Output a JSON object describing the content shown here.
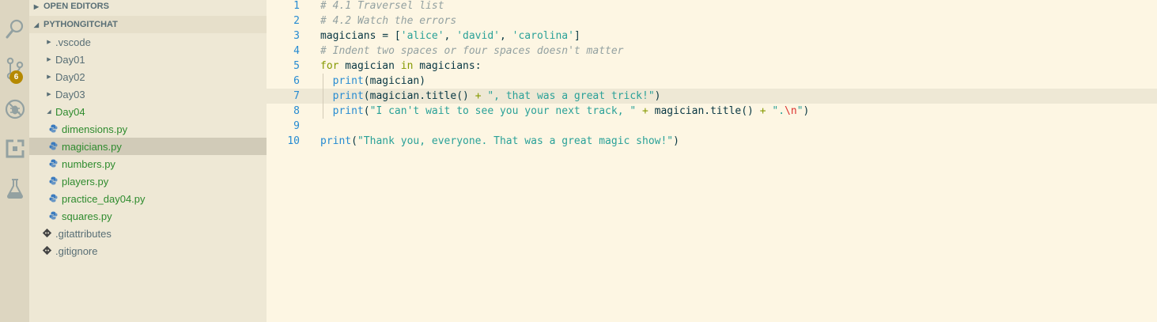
{
  "activity_bar": {
    "items": [
      {
        "icon": "search-icon"
      },
      {
        "icon": "source-control-icon",
        "badge": "6"
      },
      {
        "icon": "debug-icon"
      },
      {
        "icon": "extensions-icon"
      },
      {
        "icon": "flask-icon"
      }
    ]
  },
  "sidebar": {
    "open_editors_label": "OPEN EDITORS",
    "project_label": "PYTHONGITCHAT",
    "tree": [
      {
        "label": ".vscode",
        "kind": "folder"
      },
      {
        "label": "Day01",
        "kind": "folder"
      },
      {
        "label": "Day02",
        "kind": "folder"
      },
      {
        "label": "Day03",
        "kind": "folder"
      },
      {
        "label": "Day04",
        "kind": "folder-open"
      },
      {
        "label": "dimensions.py",
        "kind": "python",
        "status": "U"
      },
      {
        "label": "magicians.py",
        "kind": "python",
        "status": "U",
        "selected": true
      },
      {
        "label": "numbers.py",
        "kind": "python",
        "status": "U"
      },
      {
        "label": "players.py",
        "kind": "python",
        "status": "U"
      },
      {
        "label": "practice_day04.py",
        "kind": "python",
        "status": "U"
      },
      {
        "label": "squares.py",
        "kind": "python",
        "status": "U"
      },
      {
        "label": ".gitattributes",
        "kind": "git"
      },
      {
        "label": ".gitignore",
        "kind": "git"
      }
    ]
  },
  "editor": {
    "lines": [
      {
        "n": "1",
        "tokens": [
          [
            "cm",
            "# 4.1 Traversel list"
          ]
        ]
      },
      {
        "n": "2",
        "tokens": [
          [
            "cm",
            "# 4.2 Watch the errors"
          ]
        ]
      },
      {
        "n": "3",
        "tokens": [
          [
            "",
            "magicians = ["
          ],
          [
            "str",
            "'alice'"
          ],
          [
            "",
            ", "
          ],
          [
            "str",
            "'david'"
          ],
          [
            "",
            ", "
          ],
          [
            "str",
            "'carolina'"
          ],
          [
            "",
            "]"
          ]
        ]
      },
      {
        "n": "4",
        "tokens": [
          [
            "cm",
            "# Indent two spaces or four spaces doesn't matter"
          ]
        ]
      },
      {
        "n": "5",
        "tokens": [
          [
            "kw",
            "for"
          ],
          [
            "",
            " magician "
          ],
          [
            "kw",
            "in"
          ],
          [
            "",
            " magicians:"
          ]
        ]
      },
      {
        "n": "6",
        "indent": true,
        "tokens": [
          [
            "",
            "  "
          ],
          [
            "fn",
            "print"
          ],
          [
            "",
            "(magician)"
          ]
        ]
      },
      {
        "n": "7",
        "indent": true,
        "current": true,
        "tokens": [
          [
            "",
            "  "
          ],
          [
            "fn",
            "print"
          ],
          [
            "",
            "(magician.title() "
          ],
          [
            "op",
            "+"
          ],
          [
            "",
            " "
          ],
          [
            "str",
            "\", that was a great trick!\""
          ],
          [
            "",
            ")"
          ]
        ]
      },
      {
        "n": "8",
        "indent": true,
        "tokens": [
          [
            "",
            "  "
          ],
          [
            "fn",
            "print"
          ],
          [
            "",
            "("
          ],
          [
            "str",
            "\"I can't wait to see you your next track, \""
          ],
          [
            "",
            " "
          ],
          [
            "op",
            "+"
          ],
          [
            "",
            " magician.title() "
          ],
          [
            "op",
            "+"
          ],
          [
            "",
            " "
          ],
          [
            "str",
            "\"."
          ],
          [
            "esc",
            "\\n"
          ],
          [
            "str",
            "\""
          ],
          [
            "",
            ")"
          ]
        ]
      },
      {
        "n": "9",
        "tokens": []
      },
      {
        "n": "10",
        "tokens": [
          [
            "fn",
            "print"
          ],
          [
            "",
            "("
          ],
          [
            "str",
            "\"Thank you, everyone. That was a great magic show!\""
          ],
          [
            "",
            ")"
          ]
        ]
      }
    ]
  }
}
